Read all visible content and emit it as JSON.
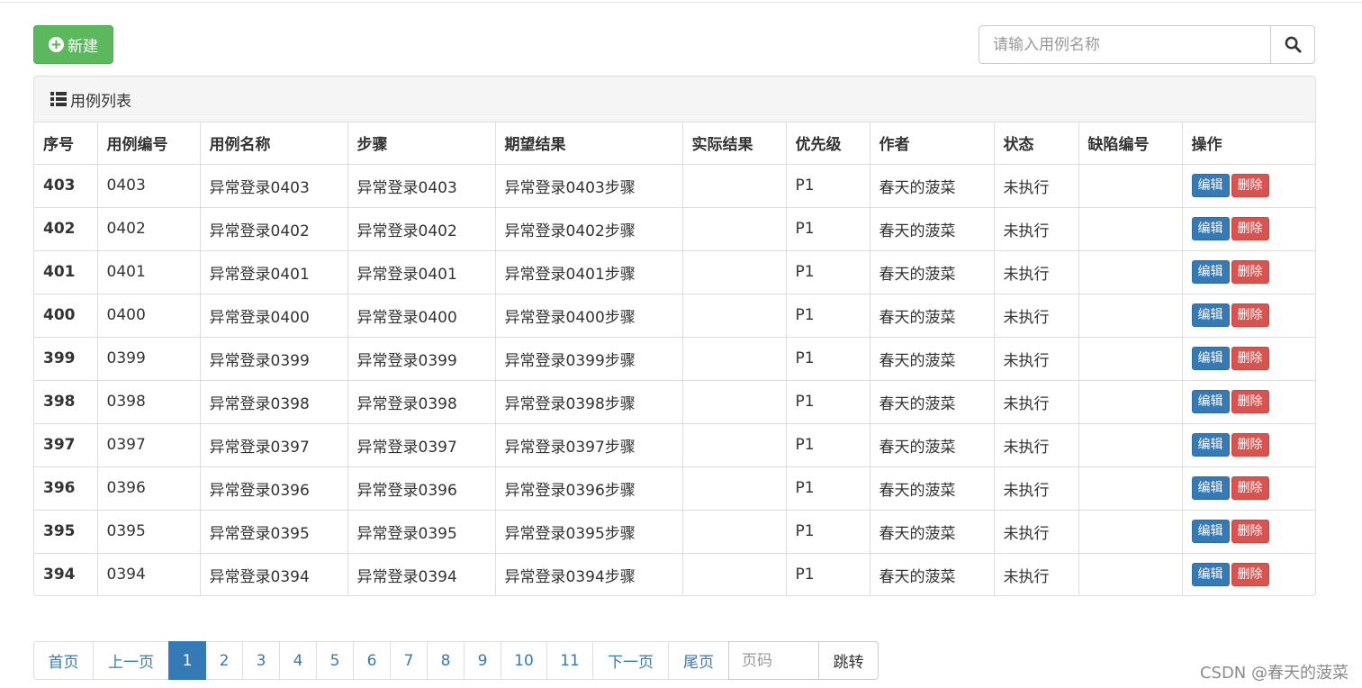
{
  "toolbar": {
    "new_label": "新建"
  },
  "search": {
    "placeholder": "请输入用例名称"
  },
  "panel": {
    "title": "用例列表"
  },
  "table": {
    "columns": [
      "序号",
      "用例编号",
      "用例名称",
      "步骤",
      "期望结果",
      "实际结果",
      "优先级",
      "作者",
      "状态",
      "缺陷编号",
      "操作"
    ],
    "edit_label": "编辑",
    "delete_label": "删除",
    "rows": [
      {
        "seq": "403",
        "id": "0403",
        "name": "异常登录0403",
        "steps": "异常登录0403",
        "expected": "异常登录0403步骤",
        "actual": "",
        "priority": "P1",
        "author": "春天的菠菜",
        "status": "未执行",
        "defect": ""
      },
      {
        "seq": "402",
        "id": "0402",
        "name": "异常登录0402",
        "steps": "异常登录0402",
        "expected": "异常登录0402步骤",
        "actual": "",
        "priority": "P1",
        "author": "春天的菠菜",
        "status": "未执行",
        "defect": ""
      },
      {
        "seq": "401",
        "id": "0401",
        "name": "异常登录0401",
        "steps": "异常登录0401",
        "expected": "异常登录0401步骤",
        "actual": "",
        "priority": "P1",
        "author": "春天的菠菜",
        "status": "未执行",
        "defect": ""
      },
      {
        "seq": "400",
        "id": "0400",
        "name": "异常登录0400",
        "steps": "异常登录0400",
        "expected": "异常登录0400步骤",
        "actual": "",
        "priority": "P1",
        "author": "春天的菠菜",
        "status": "未执行",
        "defect": ""
      },
      {
        "seq": "399",
        "id": "0399",
        "name": "异常登录0399",
        "steps": "异常登录0399",
        "expected": "异常登录0399步骤",
        "actual": "",
        "priority": "P1",
        "author": "春天的菠菜",
        "status": "未执行",
        "defect": ""
      },
      {
        "seq": "398",
        "id": "0398",
        "name": "异常登录0398",
        "steps": "异常登录0398",
        "expected": "异常登录0398步骤",
        "actual": "",
        "priority": "P1",
        "author": "春天的菠菜",
        "status": "未执行",
        "defect": ""
      },
      {
        "seq": "397",
        "id": "0397",
        "name": "异常登录0397",
        "steps": "异常登录0397",
        "expected": "异常登录0397步骤",
        "actual": "",
        "priority": "P1",
        "author": "春天的菠菜",
        "status": "未执行",
        "defect": ""
      },
      {
        "seq": "396",
        "id": "0396",
        "name": "异常登录0396",
        "steps": "异常登录0396",
        "expected": "异常登录0396步骤",
        "actual": "",
        "priority": "P1",
        "author": "春天的菠菜",
        "status": "未执行",
        "defect": ""
      },
      {
        "seq": "395",
        "id": "0395",
        "name": "异常登录0395",
        "steps": "异常登录0395",
        "expected": "异常登录0395步骤",
        "actual": "",
        "priority": "P1",
        "author": "春天的菠菜",
        "status": "未执行",
        "defect": ""
      },
      {
        "seq": "394",
        "id": "0394",
        "name": "异常登录0394",
        "steps": "异常登录0394",
        "expected": "异常登录0394步骤",
        "actual": "",
        "priority": "P1",
        "author": "春天的菠菜",
        "status": "未执行",
        "defect": ""
      }
    ]
  },
  "pagination": {
    "first": "首页",
    "prev": "上一页",
    "pages": [
      "1",
      "2",
      "3",
      "4",
      "5",
      "6",
      "7",
      "8",
      "9",
      "10",
      "11"
    ],
    "active_page": "1",
    "next": "下一页",
    "last": "尾页",
    "input_placeholder": "页码",
    "jump_label": "跳转"
  },
  "watermark": "CSDN @春天的菠菜",
  "icons": {
    "new": "plus-circle-icon",
    "search": "search-icon",
    "list": "list-icon"
  },
  "colors": {
    "success": "#5cb85c",
    "primary": "#337ab7",
    "danger": "#d9534f"
  }
}
